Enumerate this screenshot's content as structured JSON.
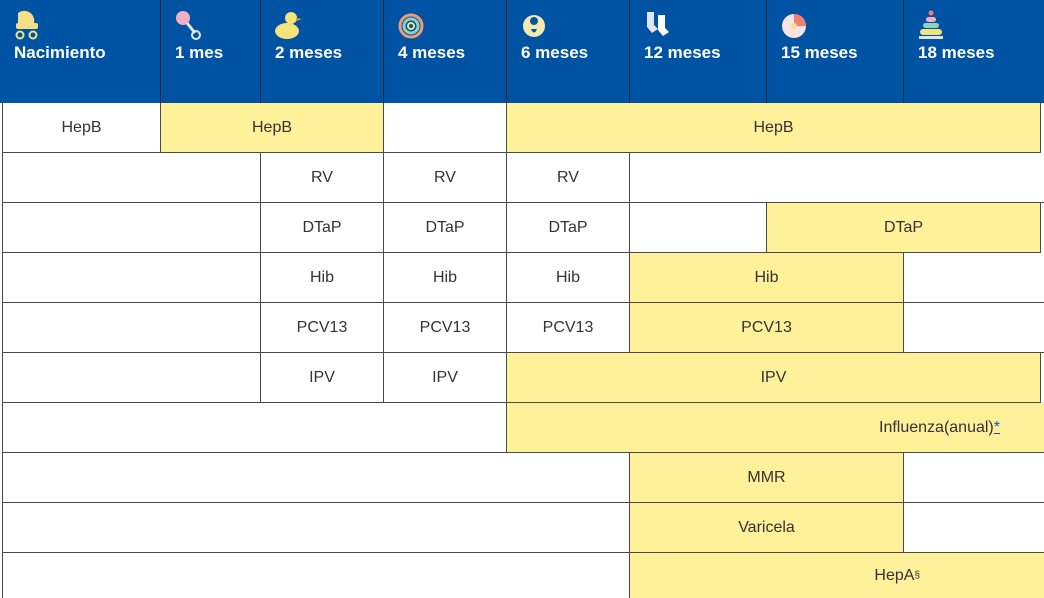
{
  "header": {
    "ages": [
      "Nacimiento",
      "1 mes",
      "2 meses",
      "4 meses",
      "6 meses",
      "12 meses",
      "15 meses",
      "18 meses"
    ],
    "icons": [
      "baby-carriage-icon",
      "rattle-icon",
      "rubber-duck-icon",
      "teething-ring-icon",
      "bib-icon",
      "baby-socks-icon",
      "ball-icon",
      "stacking-rings-icon"
    ]
  },
  "vaccines": {
    "hepb": "HepB",
    "rv": "RV",
    "dtap": "DTaP",
    "hib": "Hib",
    "pcv13": "PCV13",
    "ipv": "IPV",
    "influenza": "Influenza(anual)",
    "influenza_note": "*",
    "mmr": "MMR",
    "varicela": "Varicela",
    "hepa": "HepA",
    "hepa_note": "§"
  },
  "colors": {
    "header_bg": "#0053a2",
    "recommended_bg": "#fff09a",
    "cell_bg": "#ffffff"
  }
}
